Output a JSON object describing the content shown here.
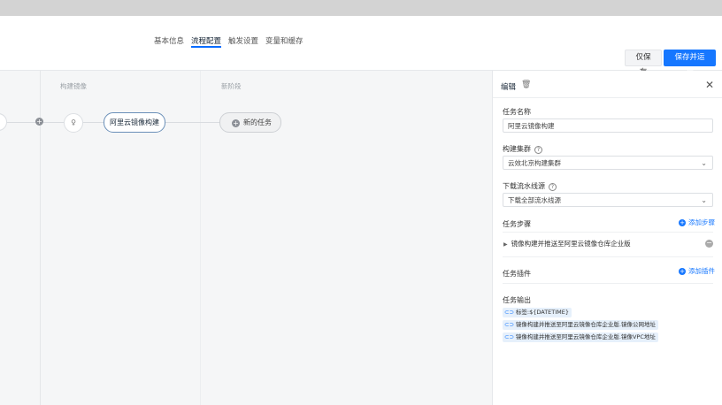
{
  "tabs": [
    {
      "label": "基本信息"
    },
    {
      "label": "流程配置"
    },
    {
      "label": "触发设置"
    },
    {
      "label": "变量和缓存"
    }
  ],
  "header": {
    "save_label": "仅保存",
    "save_run_label": "保存并运行"
  },
  "canvas": {
    "stage1_label": "构建镜像",
    "stage2_label": "新阶段",
    "job_label": "阿里云镜像构建",
    "new_task_label": "新的任务",
    "plus_glyph": "+",
    "trigger_glyph": "♀"
  },
  "panel": {
    "title": "编辑",
    "task_name_label": "任务名称",
    "task_name_value": "阿里云镜像构建",
    "cluster_label": "构建集群",
    "cluster_value": "云效北京构建集群",
    "download_label": "下载流水线源",
    "download_value": "下载全部流水线源",
    "steps_label": "任务步骤",
    "add_step_label": "添加步骤",
    "step_item": "镜像构建并推送至阿里云镜像仓库企业版",
    "plugins_label": "任务插件",
    "add_plugin_label": "添加插件",
    "output_label": "任务输出",
    "outputs": [
      "标签:${DATETIME}",
      "镜像构建并推送至阿里云镜像仓库企业版.镜像公网地址",
      "镜像构建并推送至阿里云镜像仓库企业版.镜像VPC地址"
    ]
  },
  "colors": {
    "accent": "#1677ff",
    "canvas_bg": "#f5f6f7"
  }
}
